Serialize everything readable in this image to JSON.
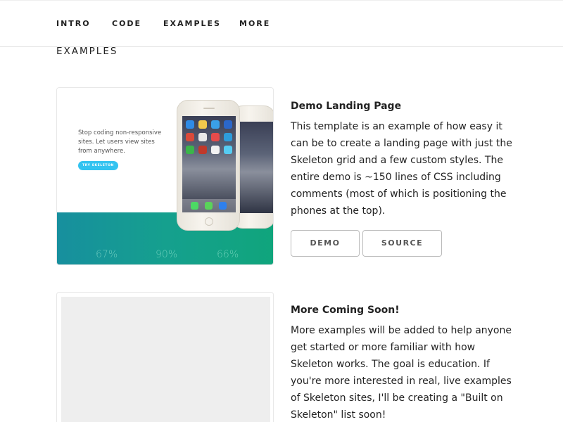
{
  "nav": {
    "items": [
      {
        "label": "INTRO"
      },
      {
        "label": "CODE"
      },
      {
        "label": "EXAMPLES"
      },
      {
        "label": "MORE"
      }
    ]
  },
  "section": {
    "title": "EXAMPLES"
  },
  "demo_card": {
    "title": "Demo Landing Page",
    "text": "This template is an example of how easy it can be to create a landing page with just the Skeleton grid and a few custom styles. The entire demo is ~150 lines of CSS including comments (most of which is positioning the phones at the top).",
    "demo_button": "DEMO",
    "source_button": "SOURCE",
    "preview": {
      "tagline": "Stop coding non-responsive sites. Let users view sites from anywhere.",
      "cta": "TRY SKELETON",
      "stats": [
        "67%",
        "90%",
        "66%"
      ]
    }
  },
  "soon_card": {
    "title": "More Coming Soon!",
    "text": "More examples will be added to help anyone get started or more familiar with how Skeleton works. The goal is education. If you're more interested in real, live examples of Skeleton sites, I'll be creating a \"Built on Skeleton\" list soon!"
  },
  "colors": {
    "accent": "#33c3f0",
    "teal": "#15a08e",
    "text": "#222222",
    "border": "#bbbbbb",
    "placeholder": "#eeeeee"
  }
}
